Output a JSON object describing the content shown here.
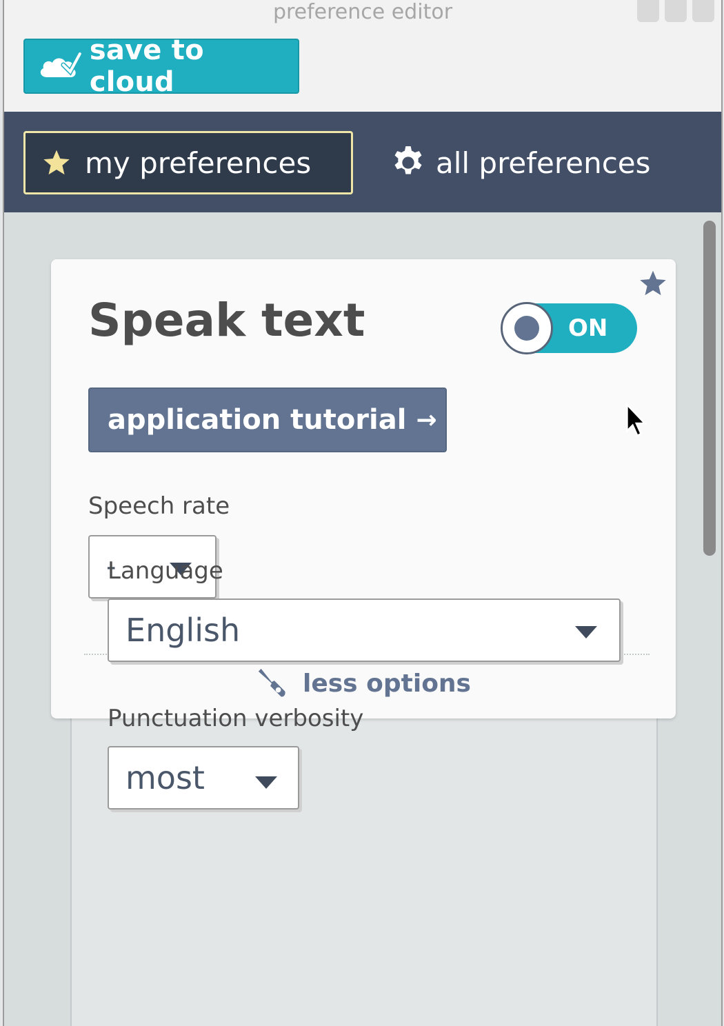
{
  "window": {
    "title": "preference editor"
  },
  "toolbar": {
    "save_label": "save to cloud",
    "save_icon": "cloud-check-icon"
  },
  "nav": {
    "tabs": [
      {
        "label": "my preferences",
        "icon": "star-icon",
        "active": true
      },
      {
        "label": "all preferences",
        "icon": "gear-icon",
        "active": false
      }
    ]
  },
  "card": {
    "title": "Speak text",
    "favorite_icon": "star-icon",
    "toggle": {
      "label": "ON",
      "state": "on"
    },
    "tutorial_button": {
      "label": "application tutorial",
      "arrow": "→"
    },
    "speech_rate": {
      "label": "Speech rate",
      "value": "-"
    },
    "less_options": {
      "label": "less options",
      "icon": "wrench-icon"
    }
  },
  "extra_options": {
    "language": {
      "label": "Language",
      "value": "English"
    },
    "punctuation": {
      "label": "Punctuation verbosity",
      "value": "most"
    }
  },
  "colors": {
    "accent": "#1fafc0",
    "nav_bg": "#424f66",
    "button_secondary": "#627491",
    "active_tab_border": "#f0e6a8"
  }
}
